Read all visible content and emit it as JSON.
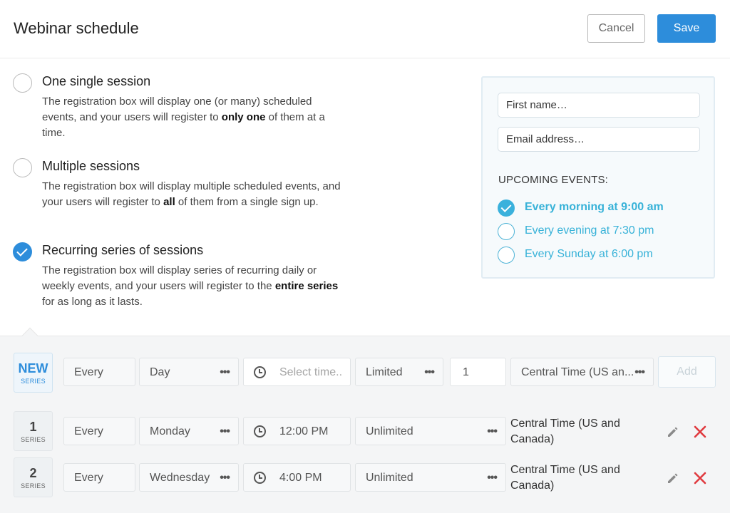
{
  "header": {
    "title": "Webinar schedule",
    "cancel_label": "Cancel",
    "save_label": "Save"
  },
  "options": [
    {
      "title": "One single session",
      "desc_before": "The registration box will display one (or many) scheduled events, and your users will register to ",
      "desc_bold": "only one",
      "desc_after": " of them at a time.",
      "checked": false
    },
    {
      "title": "Multiple sessions",
      "desc_before": "The registration box will display multiple scheduled events, and your users will register to ",
      "desc_bold": "all",
      "desc_after": " of them from a single sign up.",
      "checked": false
    },
    {
      "title": "Recurring series of sessions",
      "desc_before": "The registration box will display series of recurring daily or weekly events, and your users will register to the ",
      "desc_bold": "entire series",
      "desc_after": " for as long as it lasts.",
      "checked": true
    }
  ],
  "preview": {
    "first_name_placeholder": "First name…",
    "email_placeholder": "Email address…",
    "heading": "UPCOMING EVENTS:",
    "events": [
      {
        "label": "Every morning at 9:00 am",
        "selected": true
      },
      {
        "label": "Every evening at 7:30 pm",
        "selected": false
      },
      {
        "label": "Every Sunday at 6:00 pm",
        "selected": false
      }
    ]
  },
  "new_series": {
    "badge": "NEW",
    "badge_sub": "SERIES",
    "every": "Every",
    "frequency": "Day",
    "time_placeholder": "Select time..",
    "limit": "Limited",
    "count": "1",
    "timezone": "Central Time (US an...",
    "add_label": "Add"
  },
  "series": [
    {
      "number": "1",
      "badge_sub": "SERIES",
      "every": "Every",
      "day": "Monday",
      "time": "12:00 PM",
      "limit": "Unlimited",
      "timezone": "Central Time (US and Canada)"
    },
    {
      "number": "2",
      "badge_sub": "SERIES",
      "every": "Every",
      "day": "Wednesday",
      "time": "4:00 PM",
      "limit": "Unlimited",
      "timezone": "Central Time (US and Canada)"
    }
  ],
  "icons": {
    "dots": "•••",
    "edit": "pencil-icon",
    "delete": "close-icon",
    "clock": "clock-icon"
  },
  "colors": {
    "accent": "#2d8ddb",
    "preview_accent": "#38b2d8",
    "delete": "#e0393e"
  }
}
